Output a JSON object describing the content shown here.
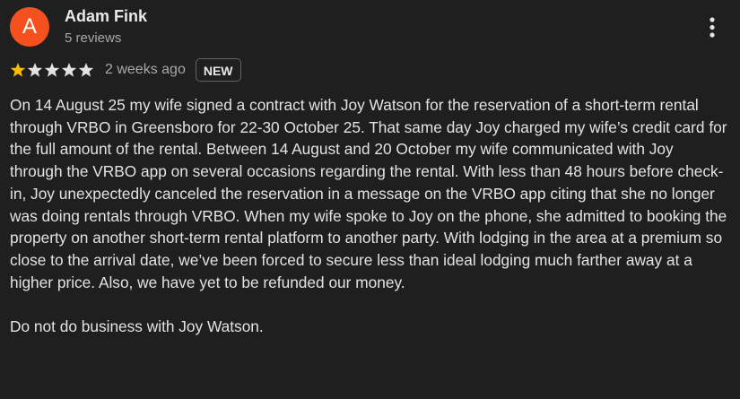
{
  "reviewer": {
    "avatar_letter": "A",
    "avatar_color": "#f4511e",
    "name": "Adam Fink",
    "reviews_count": "5 reviews"
  },
  "menu": {
    "icon": "more-vertical-icon"
  },
  "rating": {
    "stars_filled": 1,
    "stars_total": 5,
    "filled_color": "#fbbc04",
    "empty_color": "#e3e3e3",
    "time_ago": "2 weeks ago",
    "badge": "NEW"
  },
  "review_text": "On 14 August 25 my wife signed a contract with Joy Watson for the reservation of a short-term rental through VRBO in Greensboro for 22-30 October 25. That same day Joy charged my wife’s credit card for the full amount of the rental. Between 14 August and 20 October my wife communicated with Joy through the VRBO app on several occasions regarding the rental. With less than 48 hours before check-in, Joy unexpectedly canceled the reservation in a message on the VRBO app citing that she no longer was doing rentals through VRBO. When my wife spoke to Joy on the phone, she admitted to booking the property on another short-term rental platform to another party. With lodging in the area at a premium so close to the arrival date, we’ve been forced to secure less than ideal lodging much farther away at a higher price. Also, we have yet to be refunded our money.\n\nDo not do business with Joy Watson."
}
